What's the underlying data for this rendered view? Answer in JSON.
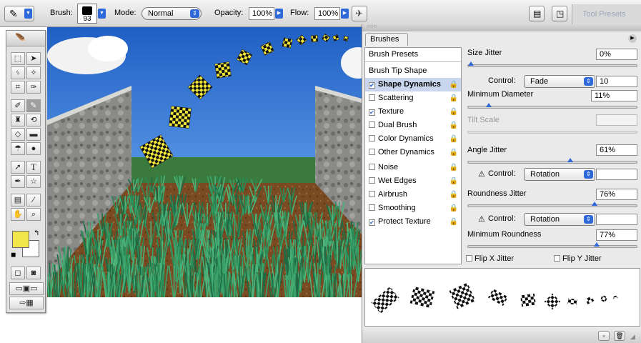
{
  "options_bar": {
    "brush_label": "Brush:",
    "brush_size": "93",
    "mode_label": "Mode:",
    "mode_value": "Normal",
    "opacity_label": "Opacity:",
    "opacity_value": "100%",
    "flow_label": "Flow:",
    "flow_value": "100%",
    "tool_presets_label": "Tool Presets"
  },
  "toolbox": {
    "foreground_color": "#f0e64a",
    "background_color": "#ffffff"
  },
  "brushes_panel": {
    "tab_label": "Brushes",
    "list": [
      {
        "label": "Brush Presets",
        "checkbox": false,
        "lock": false,
        "header": true
      },
      {
        "label": "Brush Tip Shape",
        "checkbox": false,
        "lock": false
      },
      {
        "label": "Shape Dynamics",
        "checkbox": true,
        "checked": true,
        "lock": true,
        "selected": true
      },
      {
        "label": "Scattering",
        "checkbox": true,
        "checked": false,
        "lock": true
      },
      {
        "label": "Texture",
        "checkbox": true,
        "checked": true,
        "lock": true
      },
      {
        "label": "Dual Brush",
        "checkbox": true,
        "checked": false,
        "lock": true
      },
      {
        "label": "Color Dynamics",
        "checkbox": true,
        "checked": false,
        "lock": true
      },
      {
        "label": "Other Dynamics",
        "checkbox": true,
        "checked": false,
        "lock": true
      },
      {
        "label": "Noise",
        "checkbox": true,
        "checked": false,
        "lock": true
      },
      {
        "label": "Wet Edges",
        "checkbox": true,
        "checked": false,
        "lock": true
      },
      {
        "label": "Airbrush",
        "checkbox": true,
        "checked": false,
        "lock": true
      },
      {
        "label": "Smoothing",
        "checkbox": true,
        "checked": false,
        "lock": true
      },
      {
        "label": "Protect Texture",
        "checkbox": true,
        "checked": true,
        "lock": true
      }
    ],
    "size_jitter": {
      "label": "Size Jitter",
      "value": "0%",
      "level": 0.0
    },
    "size_control": {
      "label": "Control:",
      "value": "Fade",
      "steps": "10"
    },
    "min_diameter": {
      "label": "Minimum Diameter",
      "value": "11%",
      "level": 0.11
    },
    "tilt_scale": {
      "label": "Tilt Scale",
      "value": ""
    },
    "angle_jitter": {
      "label": "Angle Jitter",
      "value": "61%",
      "level": 0.61
    },
    "angle_control": {
      "label": "Control:",
      "value": "Rotation"
    },
    "roundness_jitter": {
      "label": "Roundness Jitter",
      "value": "76%",
      "level": 0.76
    },
    "roundness_control": {
      "label": "Control:",
      "value": "Rotation"
    },
    "min_roundness": {
      "label": "Minimum Roundness",
      "value": "77%",
      "level": 0.77
    },
    "flip_x": {
      "label": "Flip X Jitter",
      "checked": false
    },
    "flip_y": {
      "label": "Flip Y Jitter",
      "checked": false
    }
  },
  "colors": {
    "sky": "#3f78d0",
    "grass": "#2a8a55",
    "soil": "#7a4a22",
    "checker_yellow": "#f2e83a",
    "accent_blue": "#2f68d8"
  }
}
